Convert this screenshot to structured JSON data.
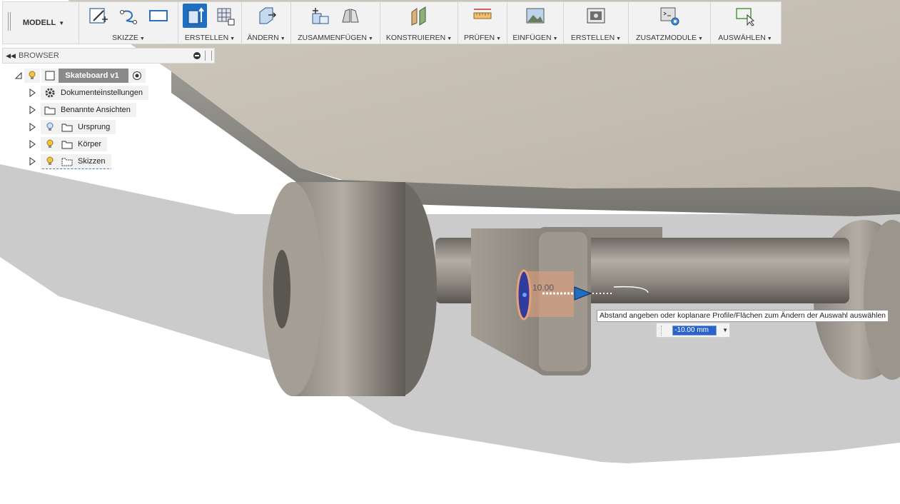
{
  "toolbar": {
    "workspace": "MODELL",
    "groups": [
      {
        "id": "skizze",
        "label": "SKIZZE"
      },
      {
        "id": "erstellen",
        "label": "ERSTELLEN"
      },
      {
        "id": "aendern",
        "label": "ÄNDERN"
      },
      {
        "id": "zusammenfuegen",
        "label": "ZUSAMMENFÜGEN"
      },
      {
        "id": "konstruieren",
        "label": "KONSTRUIEREN"
      },
      {
        "id": "pruefen",
        "label": "PRÜFEN"
      },
      {
        "id": "einfuegen",
        "label": "EINFÜGEN"
      },
      {
        "id": "erstellen2",
        "label": "ERSTELLEN"
      },
      {
        "id": "zusatzmodule",
        "label": "ZUSATZMODULE"
      },
      {
        "id": "auswaehlen",
        "label": "AUSWÄHLEN"
      }
    ]
  },
  "browser": {
    "title": "BROWSER",
    "root": "Skateboard v1",
    "items": [
      {
        "label": "Dokumenteinstellungen",
        "icon": "gear-icon"
      },
      {
        "label": "Benannte Ansichten",
        "icon": "folder-icon"
      },
      {
        "label": "Ursprung",
        "icon": "folder-icon",
        "bulb": "lightbulb-off-icon"
      },
      {
        "label": "Körper",
        "icon": "folder-icon",
        "bulb": "lightbulb-on-icon"
      },
      {
        "label": "Skizzen",
        "icon": "folder-icon",
        "bulb": "lightbulb-on-icon"
      }
    ]
  },
  "viewport": {
    "dimension_label": "10.00",
    "tooltip": "Abstand angeben oder koplanare Profile/Flächen zum Ändern der Auswahl auswählen",
    "distance_value": "-10.00 mm"
  },
  "colors": {
    "deck_top": "#c9c1b5",
    "deck_edge": "#8c8a86",
    "metal": "#7a7670",
    "shadow": "#cfcfcf",
    "active_blue": "#1f6fc0",
    "selection_orange": "#e8a07a"
  }
}
